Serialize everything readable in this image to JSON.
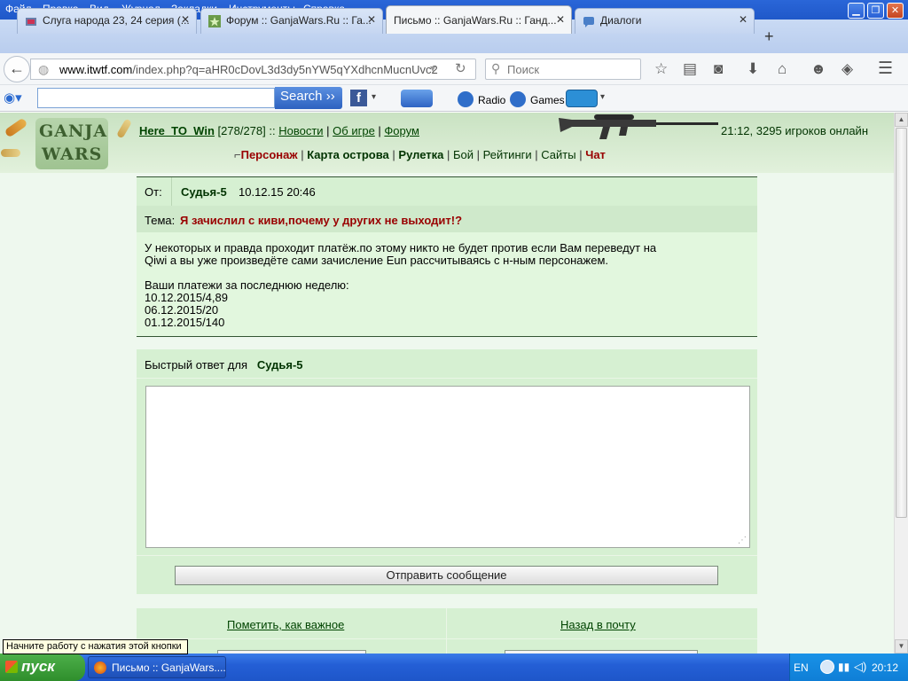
{
  "browser": {
    "menu": [
      "Файл",
      "Правка",
      "Вид",
      "Журнал",
      "Закладки",
      "Инструменты",
      "Справка"
    ],
    "tabs": [
      {
        "title": "Слуга народа 23, 24 серия (...",
        "close": "✕"
      },
      {
        "title": "Форум :: GanjaWars.Ru :: Га...",
        "close": "✕"
      },
      {
        "title": "Письмо :: GanjaWars.Ru :: Ганд...",
        "close": "✕"
      },
      {
        "title": "Диалоги",
        "close": "✕"
      }
    ],
    "new_tab": "+",
    "url_host": "www.itwtf.com",
    "url_path": "/index.php?q=aHR0cDovL3d3dy5nYW5qYXdhcnMucnUvc2",
    "search_placeholder": "Поиск",
    "toolbar": {
      "search_button": "Search",
      "radio": "Radio",
      "games": "Games"
    }
  },
  "game": {
    "logo_top": "GANJA",
    "logo_bottom": "WARS",
    "player_name": "Here_TO_Win",
    "player_hp": "[278/278]",
    "separator": "::",
    "links": [
      "Новости",
      "Об игре",
      "Форум"
    ],
    "online_status": "21:12, 3295 игроков онлайн",
    "nav": [
      "Персонаж",
      "Карта острова",
      "Рулетка",
      "Бой",
      "Рейтинги",
      "Сайты",
      "Чат"
    ]
  },
  "message": {
    "from_label": "От:",
    "from_name": "Судья-5",
    "date": "10.12.15 20:46",
    "subject_label": "Тема:",
    "subject": "Я зачислил с киви,почему у других не выходит!?",
    "body_line1": "У некоторых и правда проходит платёж.по этому никто не будет против если Вам переведут на",
    "body_line2": "Qiwi а вы уже произведёте сами зачисление Eun рассчитываясь с н-ным персонажем.",
    "payments_title": "Ваши платежи за последнюю неделю:",
    "payments": [
      "10.12.2015/4,89",
      "06.12.2015/20",
      "01.12.2015/140"
    ]
  },
  "reply": {
    "label": "Быстрый ответ для",
    "recipient": "Судья-5",
    "text": "",
    "send_button": "Отправить сообщение"
  },
  "actions": {
    "mark_important": "Пометить, как важное",
    "back_to_mail": "Назад в почту"
  },
  "taskbar": {
    "start": "пуск",
    "tooltip": "Начните работу с нажатия этой кнопки",
    "window": "Письмо :: GanjaWars....",
    "lang": "EN",
    "clock": "20:12"
  }
}
